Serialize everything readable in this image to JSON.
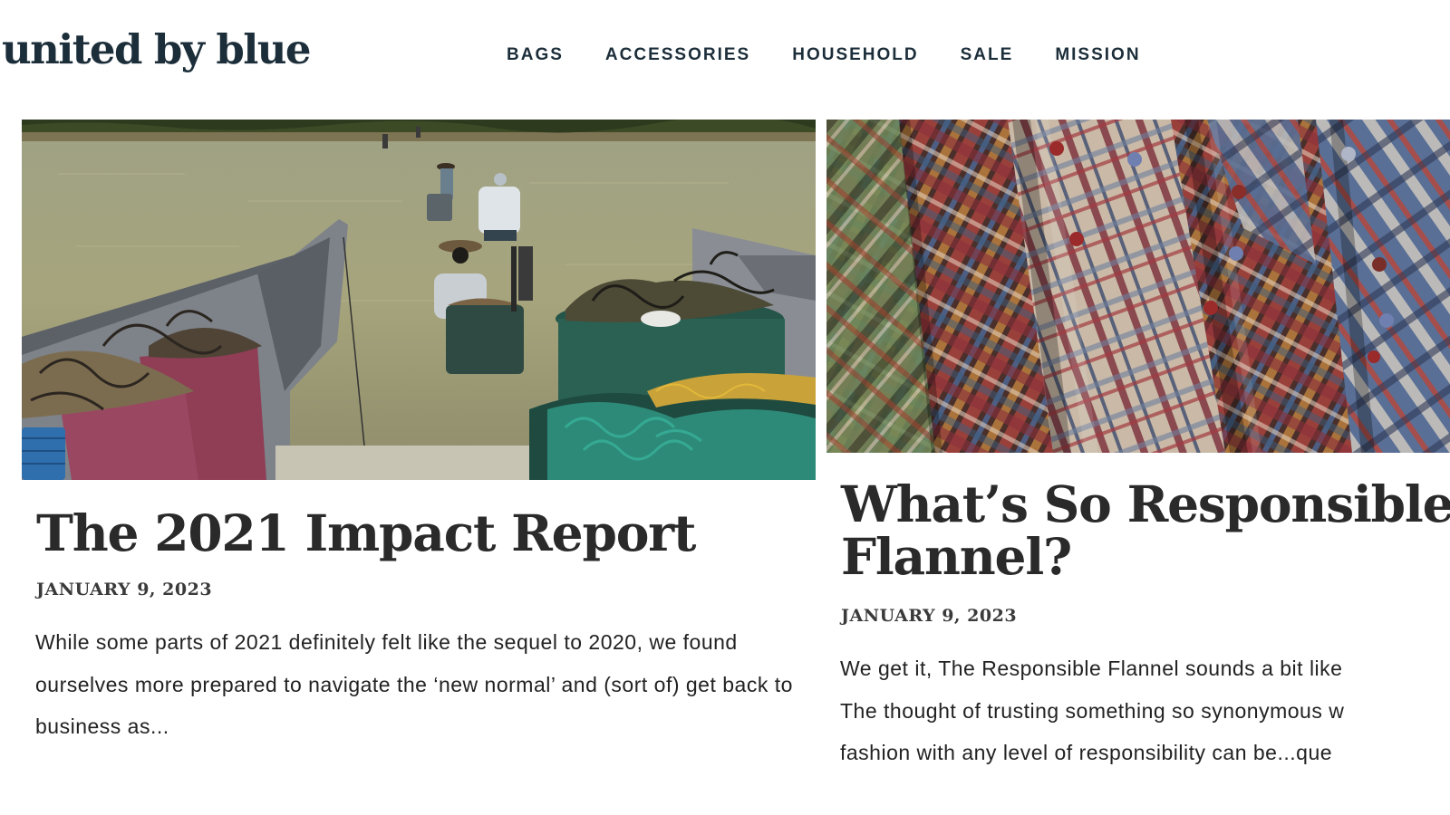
{
  "header": {
    "logo": "united by blue",
    "nav": [
      "BAGS",
      "ACCESSORIES",
      "HOUSEHOLD",
      "SALE",
      "MISSION"
    ]
  },
  "posts": [
    {
      "title": "The 2021 Impact Report",
      "date": "JANUARY 9, 2023",
      "excerpt": "While some parts of 2021 definitely felt like the sequel to 2020, we found ourselves more prepared to navigate the ‘new normal’ and (sort of) get back to business as..."
    },
    {
      "title_lines": [
        "What’s So Responsible A",
        "Flannel?"
      ],
      "date": "JANUARY 9, 2023",
      "excerpt_lines": [
        "We get it, The Responsible Flannel sounds a bit like",
        "The thought of trusting something so synonymous w",
        "fashion with any level of responsibility can be...que"
      ]
    }
  ],
  "colors": {
    "brand": "#1c2e3a",
    "heading": "#2a2a2a"
  }
}
